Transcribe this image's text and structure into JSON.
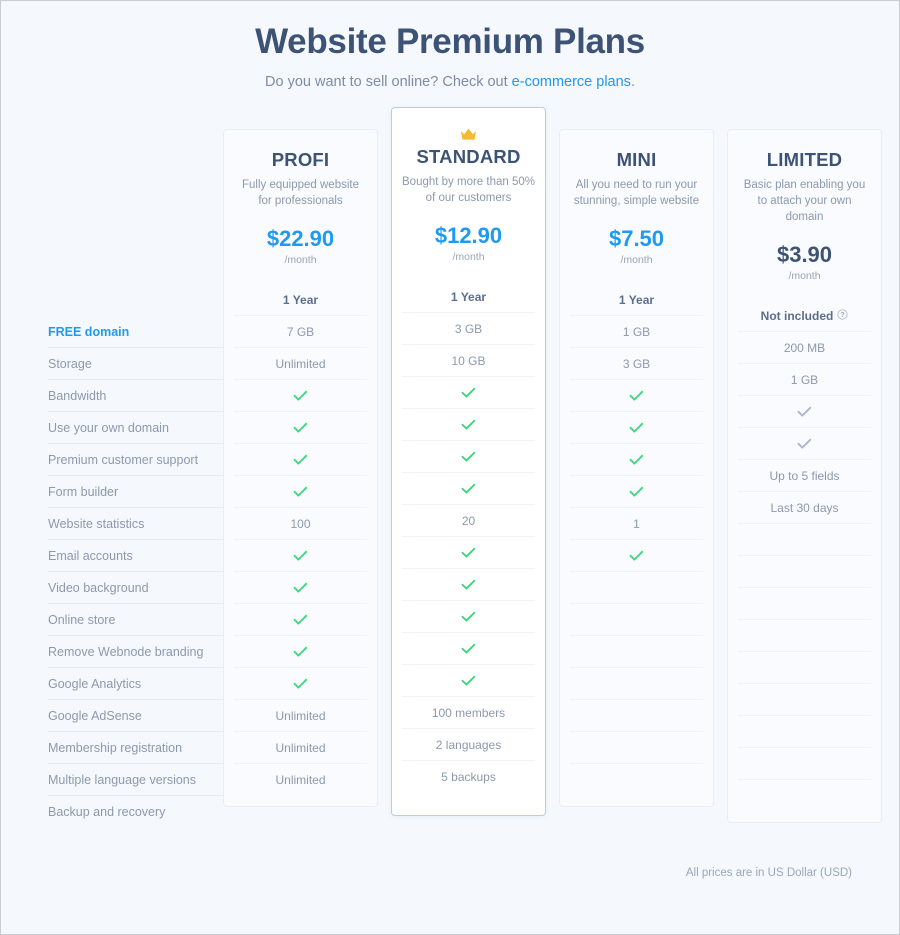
{
  "header": {
    "title": "Website Premium Plans",
    "subtitle_before": "Do you want to sell online? Check out ",
    "subtitle_link": "e-commerce plans",
    "subtitle_after": "."
  },
  "features": [
    "FREE domain",
    "Storage",
    "Bandwidth",
    "Use your own domain",
    "Premium customer support",
    "Form builder",
    "Website statistics",
    "Email accounts",
    "Video background",
    "Online store",
    "Remove Webnode branding",
    "Google Analytics",
    "Google AdSense",
    "Membership registration",
    "Multiple language versions",
    "Backup and recovery"
  ],
  "plans": [
    {
      "name": "PROFI",
      "description": "Fully equipped website for professionals",
      "price": "$22.90",
      "period": "/month",
      "featured": false,
      "crown": false,
      "price_accent": true,
      "values": [
        "1 Year",
        "7 GB",
        "Unlimited",
        "check",
        "check",
        "check",
        "check",
        "100",
        "check",
        "check",
        "check",
        "check",
        "check",
        "Unlimited",
        "Unlimited",
        "Unlimited"
      ]
    },
    {
      "name": "STANDARD",
      "description": "Bought by more than 50% of our customers",
      "price": "$12.90",
      "period": "/month",
      "featured": true,
      "crown": true,
      "price_accent": true,
      "values": [
        "1 Year",
        "3 GB",
        "10 GB",
        "check",
        "check",
        "check",
        "check",
        "20",
        "check",
        "check",
        "check",
        "check",
        "check",
        "100 members",
        "2 languages",
        "5 backups"
      ]
    },
    {
      "name": "MINI",
      "description": "All you need to run your stunning, simple website",
      "price": "$7.50",
      "period": "/month",
      "featured": false,
      "crown": false,
      "price_accent": true,
      "values": [
        "1 Year",
        "1 GB",
        "3 GB",
        "check",
        "check",
        "check",
        "check",
        "1",
        "check",
        "",
        "",
        "",
        "",
        "",
        "",
        ""
      ]
    },
    {
      "name": "LIMITED",
      "description": "Basic plan enabling you to attach your own domain",
      "price": "$3.90",
      "period": "/month",
      "featured": false,
      "crown": false,
      "price_accent": false,
      "values": [
        "Not included",
        "200 MB",
        "1 GB",
        "check-muted",
        "check-muted",
        "Up to 5 fields",
        "Last 30 days",
        "",
        "",
        "",
        "",
        "",
        "",
        "",
        "",
        ""
      ],
      "info_row": 0
    }
  ],
  "footer": {
    "note": "All prices are in US Dollar (USD)"
  },
  "icons": {
    "crown": "crown-icon",
    "check": "check-icon",
    "info": "info-icon"
  },
  "colors": {
    "accent_blue": "#1e9bf0",
    "title_navy": "#3d5376",
    "check_green": "#3ed97a",
    "check_muted": "#aab8cc",
    "crown_gold": "#f5b932",
    "page_bg": "#f5f9fd",
    "featured_border": "#a5d4f5"
  }
}
